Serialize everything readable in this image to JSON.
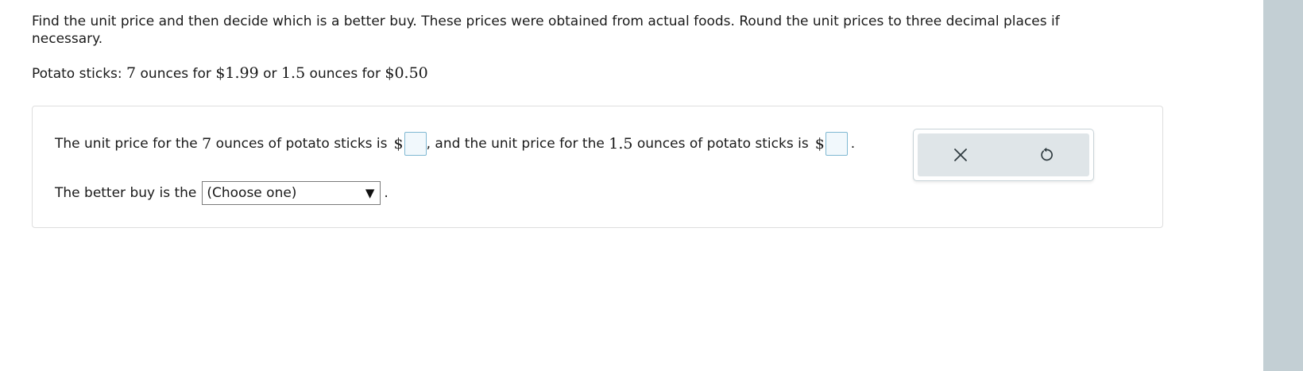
{
  "instructions": {
    "text": "Find the unit price and then decide which is a better buy. These prices were obtained from actual foods. Round the unit prices to three decimal places if necessary."
  },
  "problem": {
    "label": "Potato sticks: ",
    "qty1": "7",
    "mid1": " ounces for ",
    "price1": "$1.99",
    "or": " or ",
    "qty2": "1.5",
    "mid2": " ounces for ",
    "price2": "$0.50"
  },
  "answer": {
    "line1": {
      "part1": "The unit price for the ",
      "qty1": "7",
      "part2": " ounces of potato sticks is",
      "dollar": "$",
      "box1_value": "",
      "part3": ", and the unit price for the ",
      "qty2": "1.5",
      "part4": " ounces of potato sticks is",
      "box2_value": "",
      "end": "."
    },
    "line2": {
      "prefix": "The better buy is the",
      "select_value": "(Choose one)",
      "end": "."
    }
  },
  "tools": {
    "clear_icon": "x-icon",
    "reset_icon": "undo-icon"
  },
  "colors": {
    "answer_box_border": "#7fb8d2",
    "answer_box_fill": "#f1f8fc",
    "tool_panel_fill": "#dfe5e8",
    "scrollbar": "#c3cfd4"
  }
}
